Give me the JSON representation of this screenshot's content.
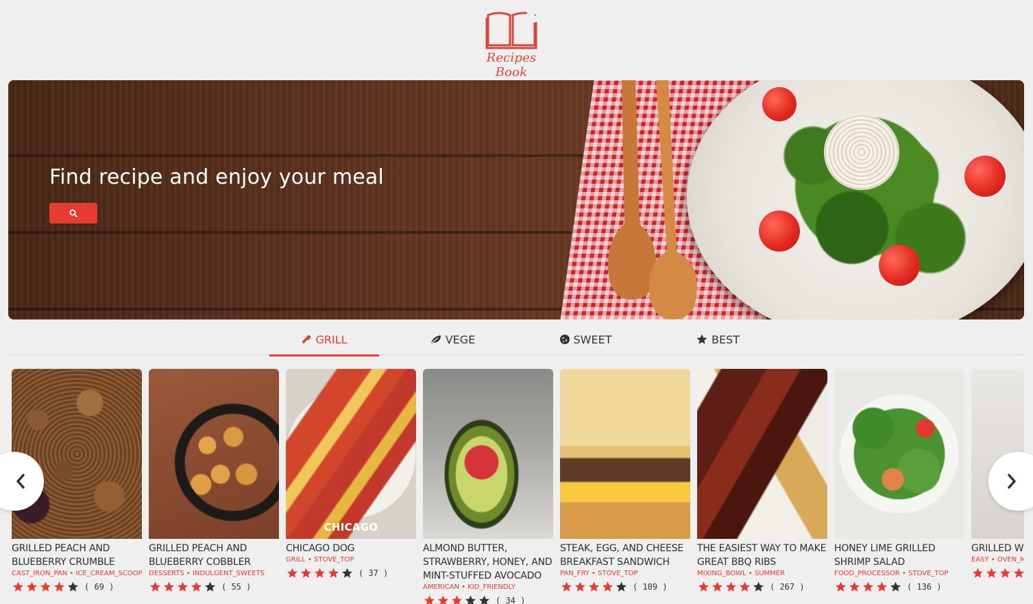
{
  "logo": {
    "text": "Recipes Book",
    "color": "#d9443a"
  },
  "hero": {
    "title": "Find recipe and enjoy your meal",
    "search_icon": "search-icon",
    "accent": "#e53b30"
  },
  "tabs": [
    {
      "label": "GRILL",
      "icon": "fire-icon",
      "active": true
    },
    {
      "label": "VEGE",
      "icon": "leaf-icon",
      "active": false
    },
    {
      "label": "SWEET",
      "icon": "cookie-icon",
      "active": false
    },
    {
      "label": "BEST",
      "icon": "star-icon",
      "active": false
    }
  ],
  "cards": [
    {
      "title": "GRILLED PEACH AND BLUEBERRY CRUMBLE",
      "tags": "CAST_IRON_PAN • ICE_CREAM_SCOOP",
      "rating": 4,
      "count": "( 69 )",
      "image_label": ""
    },
    {
      "title": "GRILLED PEACH AND BLUEBERRY COBBLER",
      "tags": "DESSERTS • INDULGENT_SWEETS",
      "rating": 4,
      "count": "( 55 )",
      "image_label": ""
    },
    {
      "title": "CHICAGO DOG",
      "tags": "GRILL • STOVE_TOP",
      "rating": 4,
      "count": "( 37 )",
      "image_label": "CHICAGO"
    },
    {
      "title": "ALMOND BUTTER, STRAWBERRY, HONEY, AND MINT-STUFFED AVOCADO",
      "tags": "AMERICAN • KID_FRIENDLY",
      "rating": 3,
      "count": "( 34 )",
      "image_label": ""
    },
    {
      "title": "STEAK, EGG, AND CHEESE BREAKFAST SANDWICH",
      "tags": "PAN_FRY • STOVE_TOP",
      "rating": 4,
      "count": "( 109 )",
      "image_label": ""
    },
    {
      "title": "THE EASIEST WAY TO MAKE GREAT BBQ RIBS",
      "tags": "MIXING_BOWL • SUMMER",
      "rating": 4,
      "count": "( 267 )",
      "image_label": ""
    },
    {
      "title": "HONEY LIME GRILLED SHRIMP SALAD",
      "tags": "FOOD_PROCESSOR • STOVE_TOP",
      "rating": 4,
      "count": "( 136 )",
      "image_label": ""
    },
    {
      "title": "GRILLED WI",
      "tags": "EASY • OVEN_MIT",
      "rating": 4,
      "count": "",
      "image_label": ""
    }
  ],
  "carousel": {
    "prev_icon": "chevron-left-icon",
    "next_icon": "chevron-right-icon"
  },
  "colors": {
    "accent": "#e53b30",
    "star": "#e53b30",
    "star_empty": "#333333"
  }
}
